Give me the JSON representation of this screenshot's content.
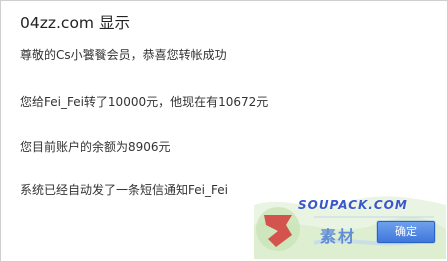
{
  "dialog": {
    "title": "04zz.com 显示",
    "lines": [
      "尊敬的Cs小饕餮会员，恭喜您转帐成功",
      "您给Fei_Fei转了10000元，他现在有10672元",
      "您目前账户的余额为8906元",
      "系统已经自动发了一条短信通知Fei_Fei"
    ],
    "ok_label": "确定"
  },
  "watermark": {
    "url_text": "SOUPACK.COM",
    "cn_text": "素材"
  }
}
